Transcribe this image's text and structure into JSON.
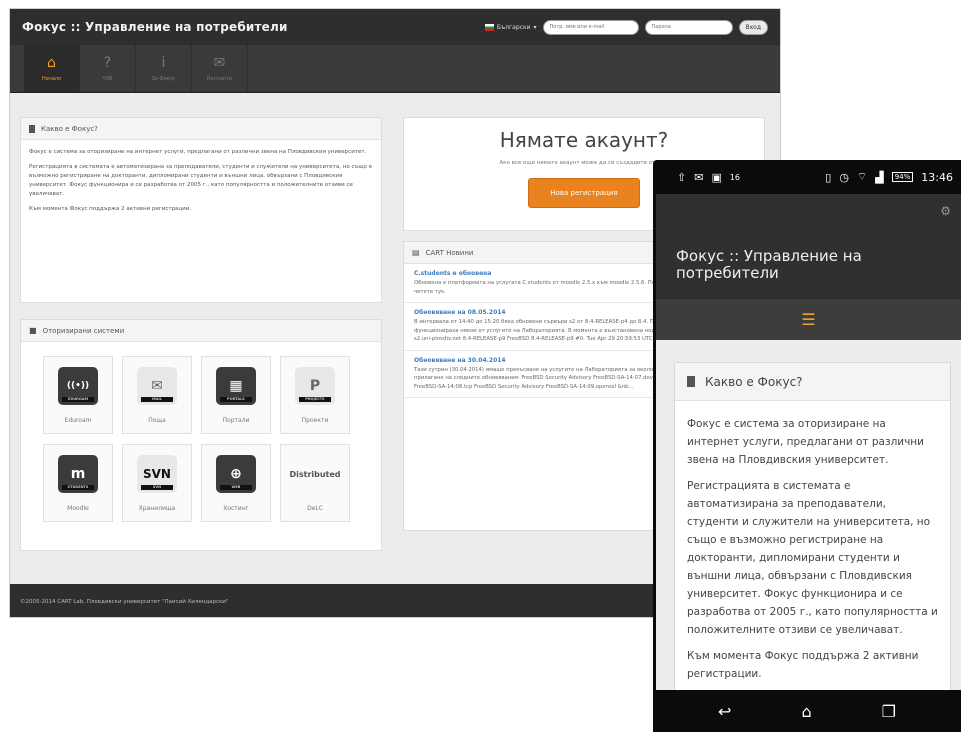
{
  "desktop": {
    "brand": "Фокус :: Управление на потребители",
    "lang_label": "Български",
    "login_user_placeholder": "Потр. име или e-mail",
    "login_pass_placeholder": "Парола",
    "login_button": "Вход",
    "nav": [
      {
        "icon": "home-icon",
        "glyph": "⌂",
        "label": "Начало",
        "active": true
      },
      {
        "icon": "question-icon",
        "glyph": "?",
        "label": "ЧЗВ",
        "active": false
      },
      {
        "icon": "info-icon",
        "glyph": "i",
        "label": "За Фокус",
        "active": false
      },
      {
        "icon": "mail-icon",
        "glyph": "✉",
        "label": "Контакти",
        "active": false
      }
    ],
    "about": {
      "title": "Какво е Фокус?",
      "paragraphs": [
        "Фокус е система за оторизиране на интернет услуги, предлагани от различни звена на Пловдивския университет.",
        "Регистрацията в системата е автоматизирана за преподаватели, студенти и служители на университета, но също е възможно регистриране на докторанти, дипломирани студенти и външни лица, обвързани с Пловдивския университет. Фокус функционира и се разработва от 2005 г., като популярността и положителните отзиви се увеличават.",
        "Към момента Фокус поддържа 2 активни регистрации."
      ]
    },
    "systems": {
      "title": "Оторизирани системи",
      "items": [
        {
          "name": "Eduroam",
          "glyph": "((•))",
          "tag": "EDUROAM"
        },
        {
          "name": "Поща",
          "glyph": "✉",
          "tag": "MAIL"
        },
        {
          "name": "Портали",
          "glyph": "▦",
          "tag": "PORTALS"
        },
        {
          "name": "Проекти",
          "glyph": "P",
          "tag": "PROJECTS"
        },
        {
          "name": "Moodle",
          "glyph": "m",
          "tag": "STUDENTS"
        },
        {
          "name": "Хранилища",
          "glyph": "SVN",
          "tag": "SVN"
        },
        {
          "name": "Хостинг",
          "glyph": "⊕",
          "tag": "WEB"
        },
        {
          "name": "DeLC",
          "glyph": "Distributed",
          "tag": ""
        }
      ]
    },
    "signup": {
      "title": "Нямате акаунт?",
      "subtitle": "Ако все още нямате акаунт може да си създадете от тук.",
      "button": "Нова регистрация"
    },
    "news": {
      "title": "CART Новини",
      "items": [
        {
          "title": "C.students е обновена",
          "text": "Обновена е платформата на услугата C.students от moodle 2.5.x към moodle 2.5.6. Повече информация за промените, четете тук."
        },
        {
          "title": "Обновяване на 08.05.2014",
          "text": "В интервала от 14:40 до 15:20 бяха обновени сървъри s2 от 8.4-RELEASE-p4 до 8.4. По време на профилактиката не функционираха някои от услугите на Лабораторията. В момента е възстановена нормалната работа. Ref.: FreeBSD s2.uni-plovdiv.net 8.4-RELEASE-p9 FreeBSD 8.4-RELEASE-p9 #0: Tue Apr 29 20:59:53 UTC 201..."
        },
        {
          "title": "Обновяване на 30.04.2014",
          "text": "Тази сутрин (30.04.2014) имаше прекъсване на услугите на Лабораторията за около 5 мин. от 8:25 до 8:30 поради прилагане на следните обновявания: FreeBSD Security Advisory FreeBSD-SA-14:07.devfs FreeBSD Security Advisory FreeBSD-SA-14:08.tcp FreeBSD Security Advisory FreeBSD-SA-14:09.openssl &nb..."
        }
      ]
    },
    "footer": "©2005-2014 CART Lab, Пловдивски университет \"Паисий Хилендарски\""
  },
  "phone": {
    "status_left": "16",
    "battery": "94%",
    "time": "13:46",
    "title": "Фокус :: Управление на потребители",
    "about_title": "Какво е Фокус?",
    "paragraphs": [
      "Фокус е система за оторизиране на интернет услуги, предлагани от различни звена на Пловдивския университет.",
      "Регистрацията в системата е автоматизирана за преподаватели, студенти и служители на университета, но също е възможно регистриране на докторанти, дипломирани студенти и външни лица, обвързани с Пловдивския университет. Фокус функционира и се разработва от 2005 г., като популярността и положителните отзиви се увеличават.",
      "Към момента Фокус поддържа 2 активни регистрации."
    ]
  },
  "colors": {
    "accent": "#e8831f",
    "dark": "#2e2e2e",
    "link": "#3a7cc0"
  }
}
